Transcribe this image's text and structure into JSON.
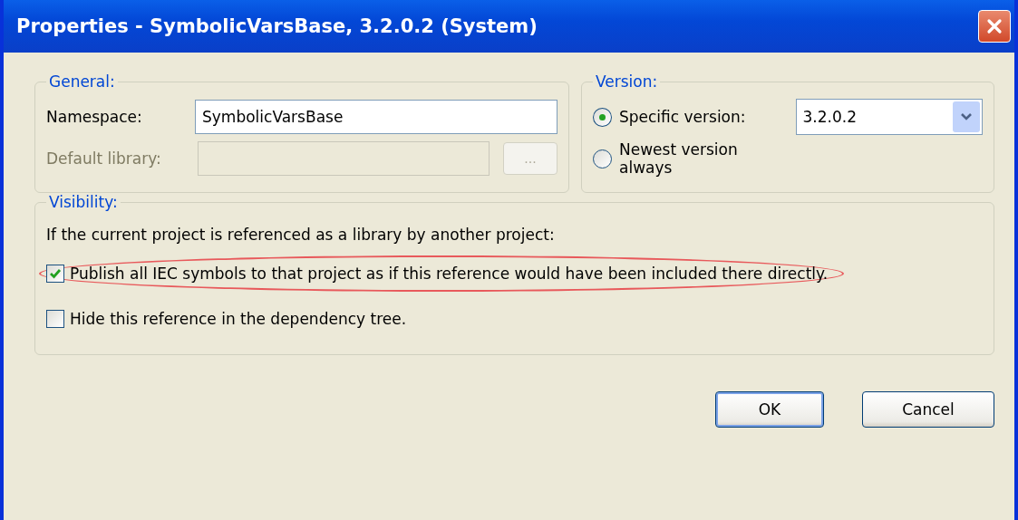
{
  "window": {
    "title": "Properties - SymbolicVarsBase, 3.2.0.2 (System)"
  },
  "general": {
    "legend": "General:",
    "fields": [
      {
        "kind": "text",
        "label": "Namespace:",
        "value": "SymbolicVarsBase",
        "disabled": false
      },
      {
        "kind": "browse",
        "label": "Default library:",
        "disabled": true,
        "browse_button": "..."
      }
    ]
  },
  "version": {
    "legend": "Version:",
    "options": [
      {
        "label": "Specific version:",
        "selected": true,
        "dropdown": "3.2.0.2"
      },
      {
        "label": "Newest version always",
        "selected": false
      }
    ]
  },
  "visibility": {
    "legend": "Visibility:",
    "intro": "If the current project is referenced as a library by another project:",
    "options": [
      {
        "label": "Publish all IEC symbols to that project as if this reference would have been included there directly.",
        "checked": true,
        "highlighted": true
      },
      {
        "label": "Hide this reference in the dependency tree.",
        "checked": false,
        "highlighted": false
      }
    ]
  },
  "buttons": [
    {
      "label": "OK",
      "default": true
    },
    {
      "label": "Cancel",
      "default": false
    }
  ]
}
